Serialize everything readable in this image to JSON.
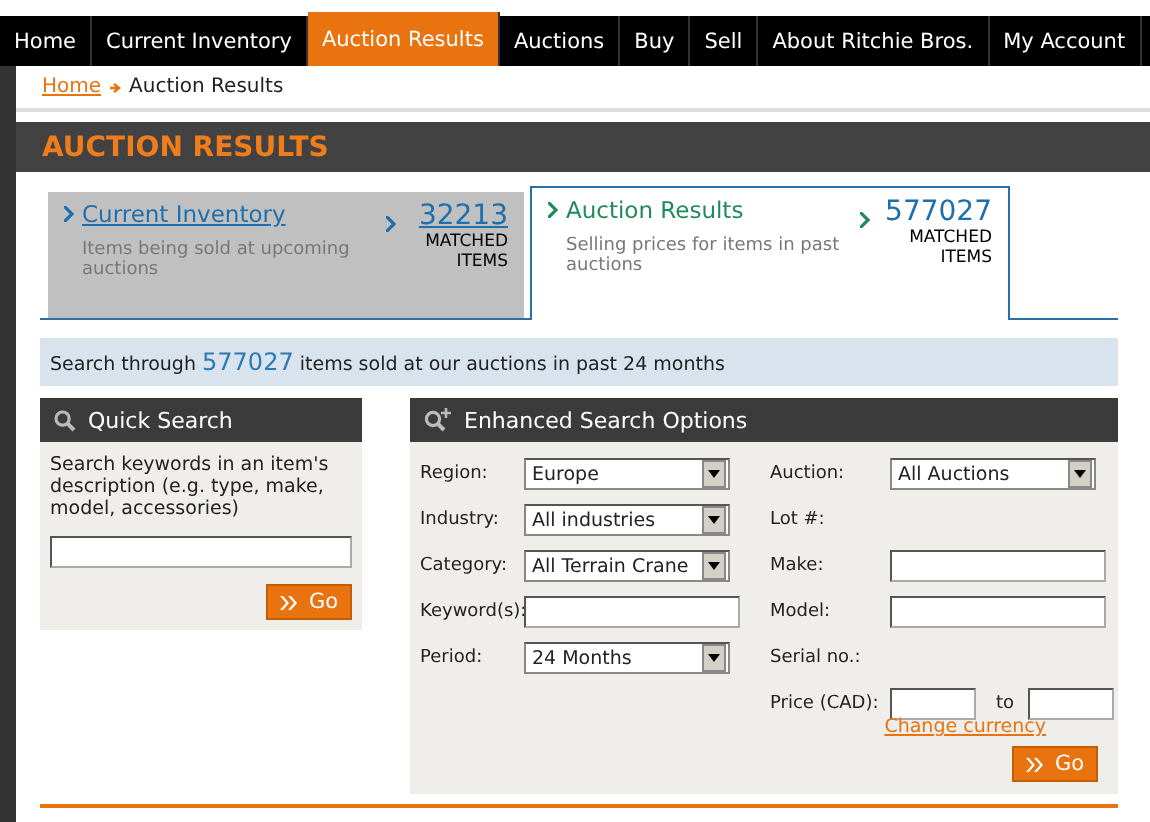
{
  "nav": [
    {
      "label": "Home",
      "selected": false
    },
    {
      "label": "Current Inventory",
      "selected": false
    },
    {
      "label": "Auction Results",
      "selected": true
    },
    {
      "label": "Auctions",
      "selected": false
    },
    {
      "label": "Buy",
      "selected": false
    },
    {
      "label": "Sell",
      "selected": false
    },
    {
      "label": "About Ritchie Bros.",
      "selected": false
    },
    {
      "label": "My Account",
      "selected": false
    }
  ],
  "breadcrumb": {
    "link": "Home",
    "current": "Auction Results"
  },
  "page_title": "AUCTION RESULTS",
  "tabs": [
    {
      "title": "Current Inventory",
      "description": "Items being sold at upcoming auctions",
      "count": "32213",
      "count_label": "MATCHED ITEMS",
      "selected": false
    },
    {
      "title": "Auction Results",
      "description": "Selling prices for items in past auctions",
      "count": "577027",
      "count_label": "MATCHED ITEMS",
      "selected": true
    }
  ],
  "info": {
    "before": "Search through",
    "count": "577027",
    "after": "items sold at our auctions in past 24 months"
  },
  "quick_search": {
    "title": "Quick Search",
    "description": "Search keywords in an item's description (e.g. type, make, model, accessories)",
    "go_label": "Go"
  },
  "enhanced": {
    "title": "Enhanced Search Options",
    "left_fields": [
      {
        "kind": "select",
        "label": "Region:",
        "value": "Europe"
      },
      {
        "kind": "select",
        "label": "Industry:",
        "value": "All industries"
      },
      {
        "kind": "select",
        "label": "Category:",
        "value": "All Terrain Crane"
      },
      {
        "kind": "text",
        "label": "Keyword(s):"
      },
      {
        "kind": "select",
        "label": "Period:",
        "value": "24 Months"
      }
    ],
    "right_fields": [
      {
        "kind": "select",
        "label": "Auction:",
        "value": "All Auctions"
      },
      {
        "kind": "none",
        "label": "Lot #:"
      },
      {
        "kind": "text",
        "label": "Make:"
      },
      {
        "kind": "text",
        "label": "Model:"
      },
      {
        "kind": "none",
        "label": "Serial no.:"
      },
      {
        "kind": "range",
        "label": "Price (CAD):",
        "range_label": "to"
      }
    ],
    "link": "Change currency",
    "go_label": "Go"
  }
}
